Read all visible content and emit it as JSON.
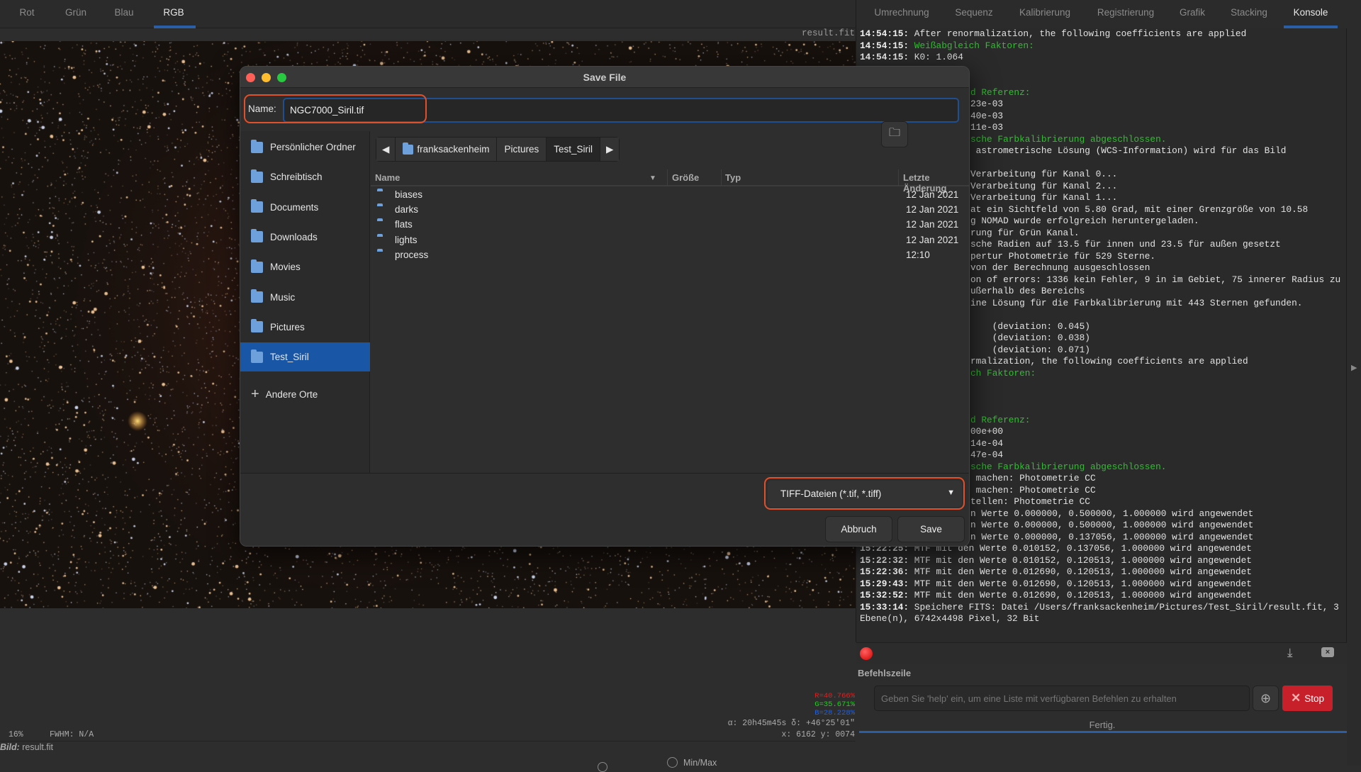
{
  "left_tabs": [
    "Rot",
    "Grün",
    "Blau",
    "RGB"
  ],
  "left_active_tab": "RGB",
  "right_tabs": [
    "Umrechnung",
    "Sequenz",
    "Kalibrierung",
    "Registrierung",
    "Grafik",
    "Stacking",
    "Konsole"
  ],
  "right_active_tab": "Konsole",
  "image_overlay_name": "result.fit",
  "console": {
    "lines": [
      {
        "ts": "14:54:15:",
        "msg": " After renormalization, the following coefficients are applied"
      },
      {
        "ts": "14:54:15:",
        "msg": " Weißabgleich Faktoren:",
        "color": "green"
      },
      {
        "ts": "14:54:15:",
        "msg": " K0: 1.064"
      },
      {
        "msg": ""
      },
      {
        "msg": ""
      },
      {
        "msg": "d Referenz:",
        "color": "green",
        "partial": true
      },
      {
        "msg": "23e-03",
        "partial": true
      },
      {
        "msg": "40e-03",
        "partial": true
      },
      {
        "msg": "11e-03",
        "partial": true
      },
      {
        "msg": "sche Farbkalibrierung abgeschlossen.",
        "color": "green",
        "partial": true
      },
      {
        "msg": " astrometrische Lösung (WCS-Information) wird für das Bild",
        "partial": true
      },
      {
        "msg": ""
      },
      {
        "msg": "Verarbeitung für Kanal 0...",
        "partial": true
      },
      {
        "msg": "Verarbeitung für Kanal 2...",
        "partial": true
      },
      {
        "msg": "Verarbeitung für Kanal 1...",
        "partial": true
      },
      {
        "msg": "at ein Sichtfeld von 5.80 Grad, mit einer Grenzgröße von 10.58",
        "partial": true
      },
      {
        "msg": "g NOMAD wurde erfolgreich heruntergeladen.",
        "partial": true
      },
      {
        "msg": "rung für Grün Kanal.",
        "partial": true
      },
      {
        "msg": "sche Radien auf 13.5 für innen und 23.5 für außen gesetzt",
        "partial": true
      },
      {
        "msg": "pertur Photometrie für 529 Sterne.",
        "partial": true
      },
      {
        "msg": "von der Berechnung ausgeschlossen",
        "partial": true
      },
      {
        "msg": "on of errors: 1336 kein Fehler, 9 in im Gebiet, 75 innerer Radius zu",
        "partial": true
      },
      {
        "msg": "ußerhalb des Bereichs",
        "partial": true
      },
      {
        "msg": "ine Lösung für die Farbkalibrierung mit 443 Sternen gefunden.",
        "partial": true
      },
      {
        "msg": ""
      },
      {
        "msg": "    (deviation: 0.045)",
        "partial": true
      },
      {
        "msg": "    (deviation: 0.038)",
        "partial": true
      },
      {
        "msg": "    (deviation: 0.071)",
        "partial": true
      },
      {
        "msg": "rmalization, the following coefficients are applied",
        "partial": true
      },
      {
        "msg": "ch Faktoren:",
        "color": "green",
        "partial": true
      },
      {
        "msg": ""
      },
      {
        "msg": ""
      },
      {
        "msg": ""
      },
      {
        "msg": "d Referenz:",
        "color": "green",
        "partial": true
      },
      {
        "msg": "00e+00",
        "partial": true
      },
      {
        "msg": "14e-04",
        "partial": true
      },
      {
        "msg": "47e-04",
        "partial": true
      },
      {
        "msg": "sche Farbkalibrierung abgeschlossen.",
        "color": "green",
        "partial": true
      },
      {
        "msg": " machen: Photometrie CC",
        "partial": true
      },
      {
        "msg": " machen: Photometrie CC",
        "partial": true
      },
      {
        "msg": "tellen: Photometrie CC",
        "partial": true
      },
      {
        "msg": "n Werte 0.000000, 0.500000, 1.000000 wird angewendet",
        "partial": true
      },
      {
        "msg": "n Werte 0.000000, 0.500000, 1.000000 wird angewendet",
        "partial": true
      },
      {
        "msg": "n Werte 0.000000, 0.137056, 1.000000 wird angewendet",
        "partial": true
      },
      {
        "ts": "15:22:25:",
        "msg": " MTF mit den Werte 0.010152, 0.137056, 1.000000 wird angewendet"
      },
      {
        "ts": "15:22:32:",
        "msg": " MTF mit den Werte 0.010152, 0.120513, 1.000000 wird angewendet"
      },
      {
        "ts": "15:22:36:",
        "msg": " MTF mit den Werte 0.012690, 0.120513, 1.000000 wird angewendet"
      },
      {
        "ts": "15:29:43:",
        "msg": " MTF mit den Werte 0.012690, 0.120513, 1.000000 wird angewendet"
      },
      {
        "ts": "15:32:52:",
        "msg": " MTF mit den Werte 0.012690, 0.120513, 1.000000 wird angewendet"
      },
      {
        "ts": "15:33:14:",
        "msg": " Speichere FITS: Datei /Users/franksackenheim/Pictures/Test_Siril/result.fit, 3"
      },
      {
        "msg": "Ebene(n), 6742x4498 Pixel, 32 Bit"
      }
    ],
    "command_label": "Befehlszeile",
    "command_placeholder": "Geben Sie 'help' ein, um eine Liste mit verfügbaren Befehlen zu erhalten",
    "stop_label": "Stop",
    "status": "Fertig."
  },
  "dialog": {
    "title": "Save File",
    "name_label": "Name:",
    "name_value": "NGC7000_Siril.tif",
    "places": [
      {
        "label": "Persönlicher Ordner"
      },
      {
        "label": "Schreibtisch"
      },
      {
        "label": "Documents"
      },
      {
        "label": "Downloads"
      },
      {
        "label": "Movies"
      },
      {
        "label": "Music"
      },
      {
        "label": "Pictures"
      },
      {
        "label": "Test_Siril",
        "selected": true
      }
    ],
    "other_locations": "Andere Orte",
    "path": [
      "franksackenheim",
      "Pictures",
      "Test_Siril"
    ],
    "columns": {
      "name": "Name",
      "size": "Größe",
      "type": "Typ",
      "modified": "Letzte Änderung"
    },
    "files": [
      {
        "name": "biases",
        "modified": "12 Jan 2021"
      },
      {
        "name": "darks",
        "modified": "12 Jan 2021"
      },
      {
        "name": "flats",
        "modified": "12 Jan 2021"
      },
      {
        "name": "lights",
        "modified": "12 Jan 2021"
      },
      {
        "name": "process",
        "modified": "12:10"
      }
    ],
    "filter": "TIFF-Dateien (*.tif, *.tiff)",
    "cancel_label": "Abbruch",
    "save_label": "Save"
  },
  "status": {
    "zoom": "16%",
    "fwhm": "FWHM: N/A",
    "r": "R=40.766%",
    "g": "G=35.671%",
    "b": "B=28.228%",
    "coords_sky": "α: 20h45m45s δ: +46°25'01\"",
    "coords_px": "x: 6162 y: 0074",
    "image_label": "Bild:",
    "image_name": "result.fit",
    "minmax": "Min/Max"
  },
  "colors": {
    "accent": "#1a56a6",
    "stop": "#c8202a",
    "console_green": "#2fbf2f",
    "highlight": "#e0502a"
  }
}
